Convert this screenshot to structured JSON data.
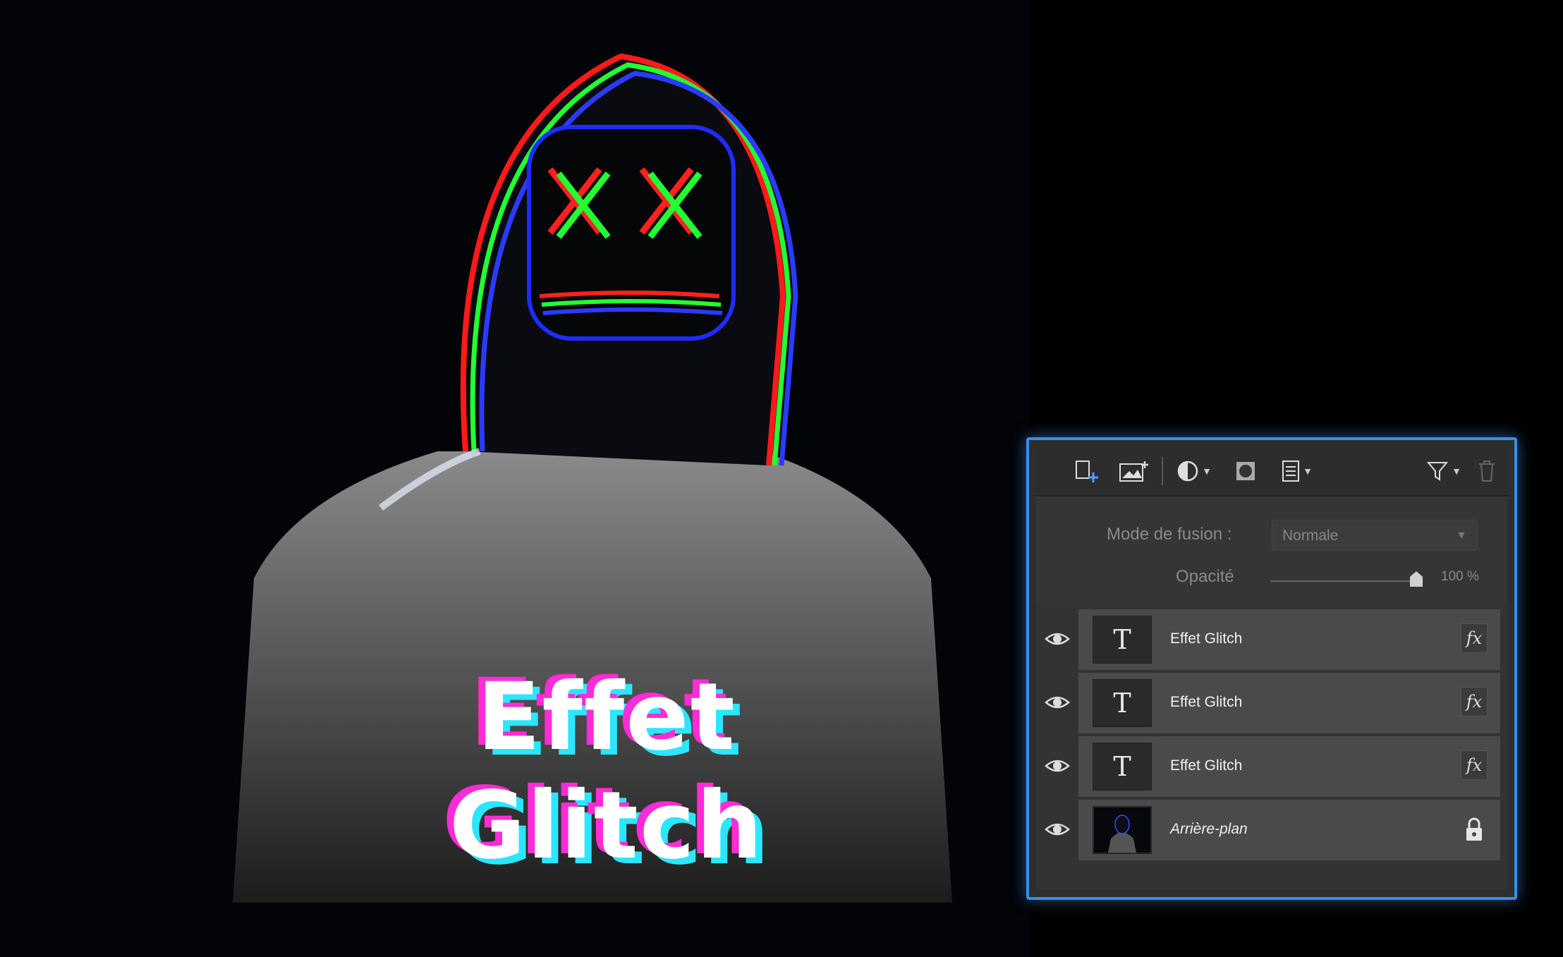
{
  "artwork": {
    "title_text": "Effet Glitch"
  },
  "layers_panel": {
    "toolbar": {
      "icons": [
        "new-layer-icon",
        "add-image-layer-icon",
        "adjustment-layer-icon",
        "mask-icon",
        "layer-menu-icon",
        "filter-icon",
        "delete-icon"
      ]
    },
    "blend_mode": {
      "label": "Mode de fusion :",
      "value": "Normale"
    },
    "opacity": {
      "label": "Opacité",
      "value": "100 %",
      "level": 1.0
    },
    "layers": [
      {
        "name": "Effet Glitch",
        "type": "text",
        "thumb": "T",
        "fx": "fx"
      },
      {
        "name": "Effet Glitch",
        "type": "text",
        "thumb": "T",
        "fx": "fx"
      },
      {
        "name": "Effet Glitch",
        "type": "text",
        "thumb": "T",
        "fx": "fx"
      },
      {
        "name": "Arrière-plan",
        "type": "image",
        "locked": true
      }
    ],
    "accent_color": "#3a8ee6"
  }
}
